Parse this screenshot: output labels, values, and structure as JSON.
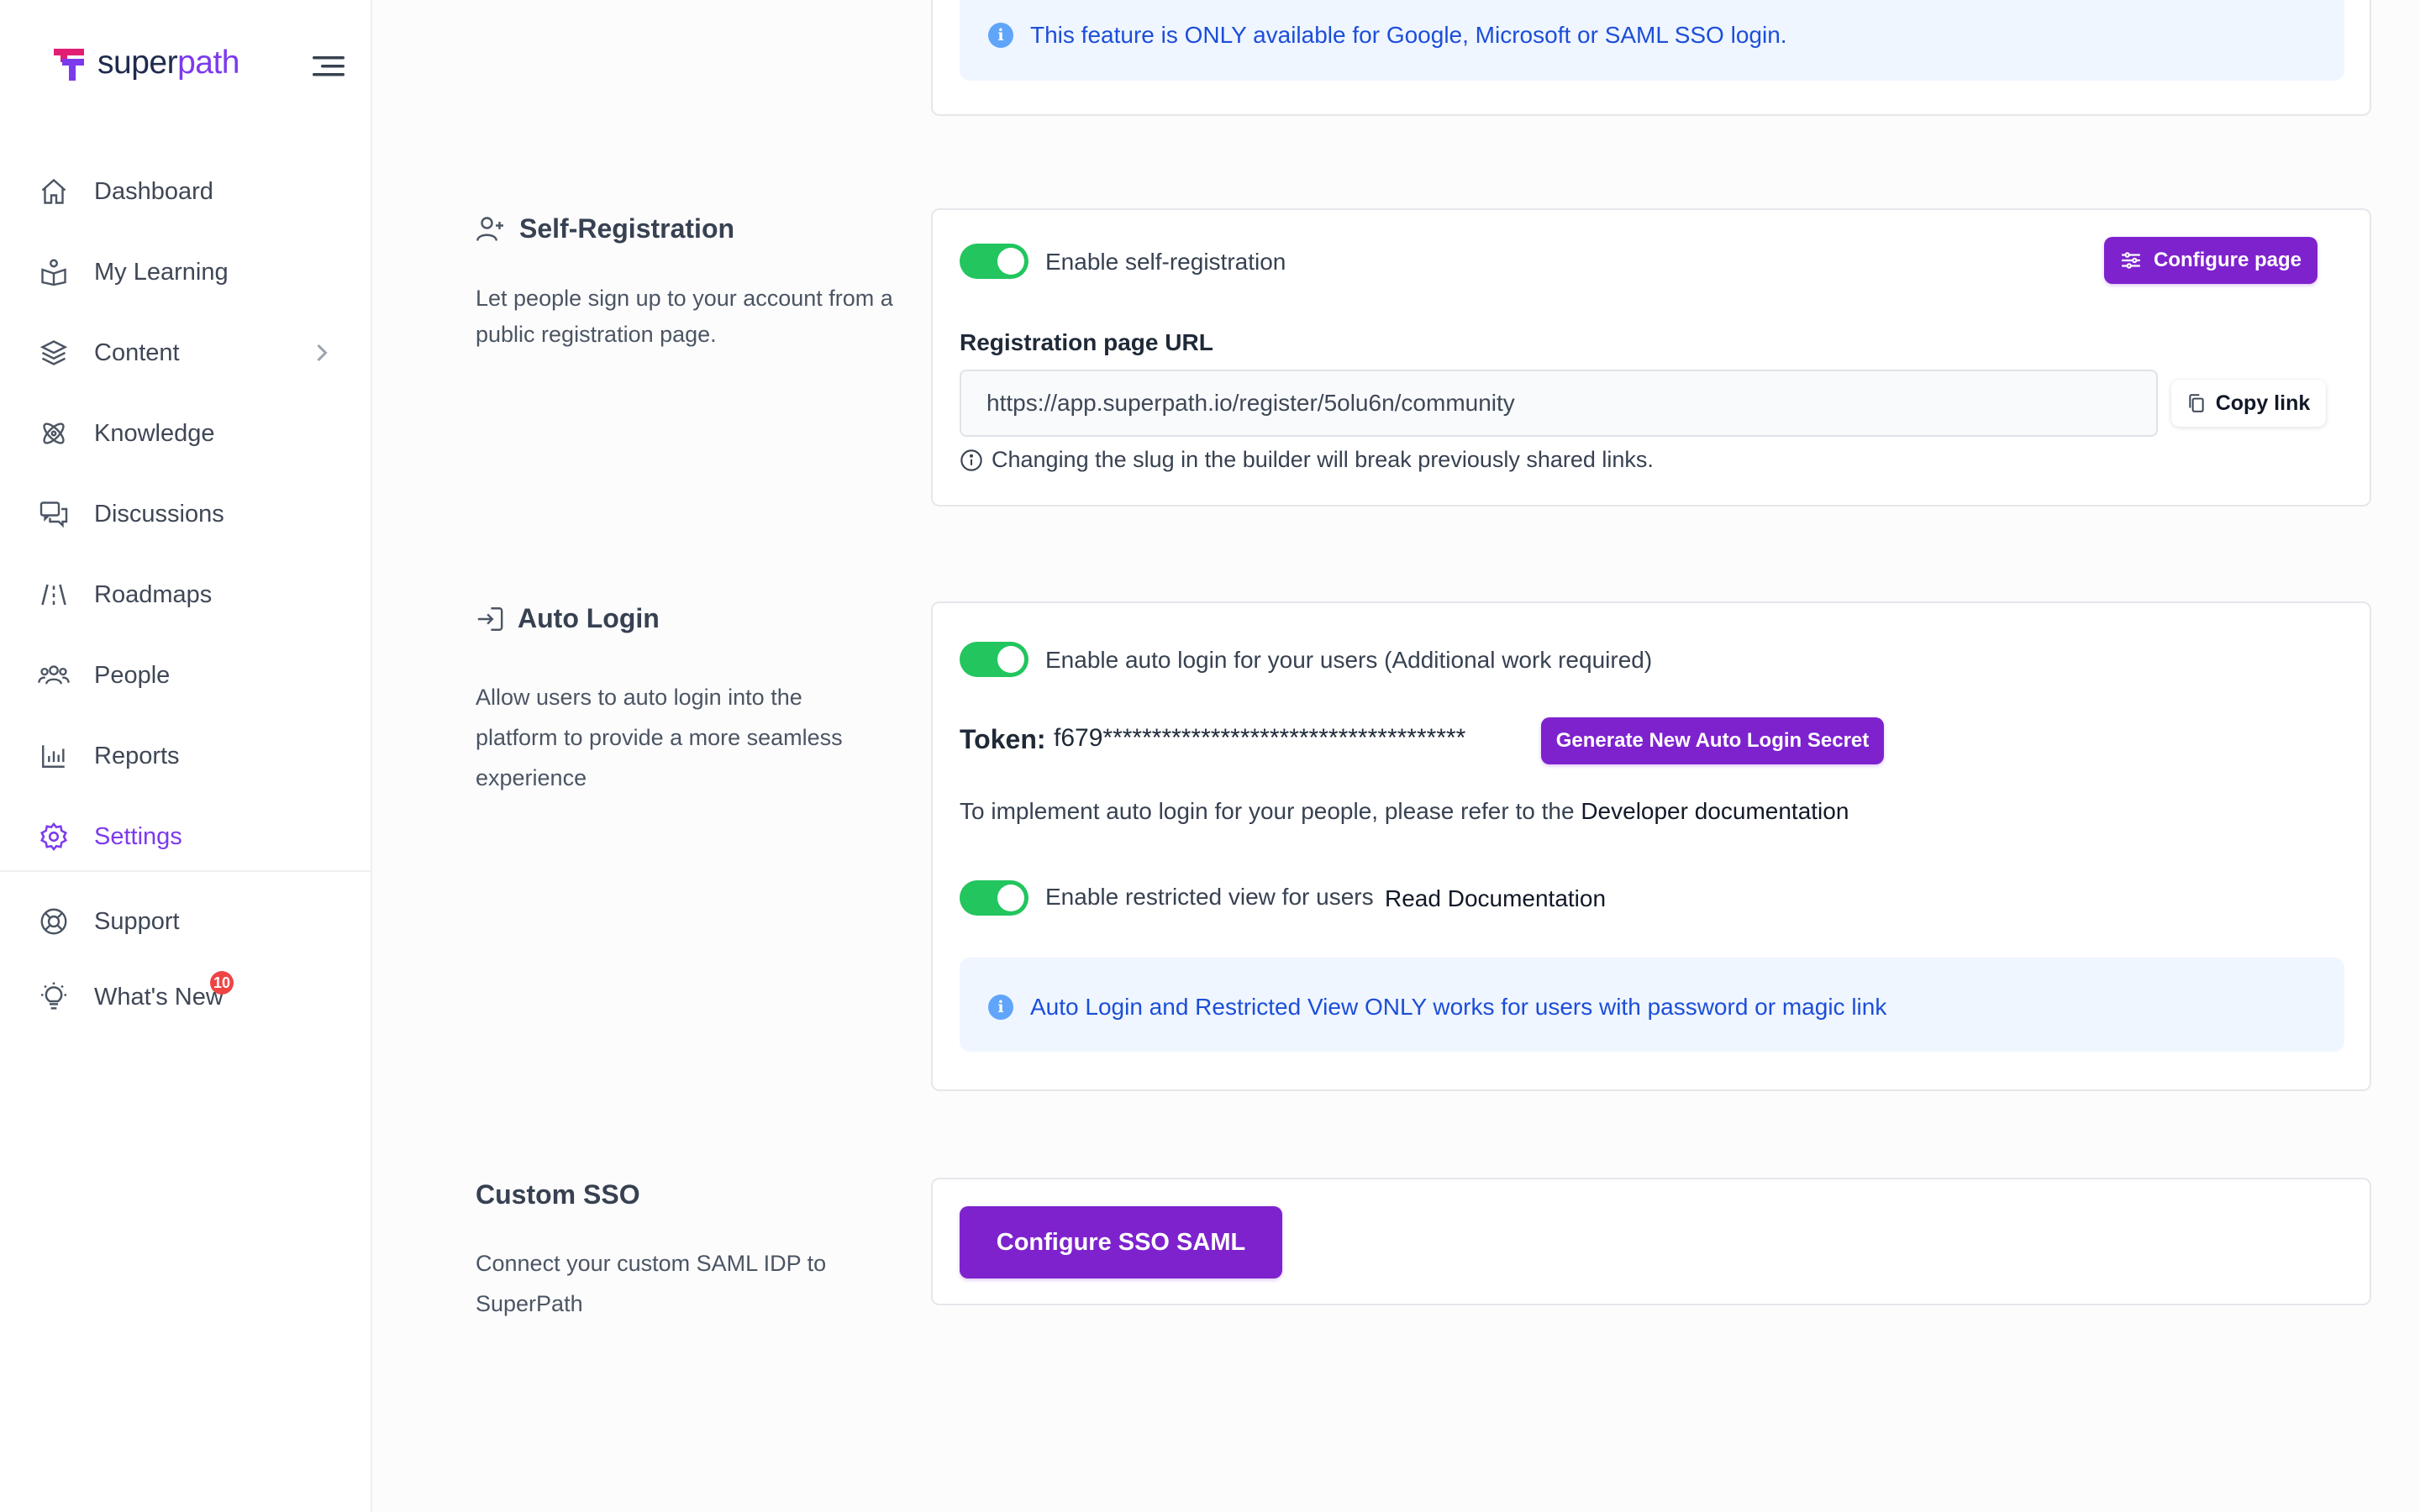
{
  "brand": {
    "name_prefix": "super",
    "name_suffix": "path",
    "accent": "#7c3aed"
  },
  "sidebar": {
    "items": [
      {
        "label": "Dashboard",
        "icon": "home-icon"
      },
      {
        "label": "My Learning",
        "icon": "learning-icon"
      },
      {
        "label": "Content",
        "icon": "layers-icon"
      },
      {
        "label": "Knowledge",
        "icon": "atom-icon"
      },
      {
        "label": "Discussions",
        "icon": "chat-icon"
      },
      {
        "label": "Roadmaps",
        "icon": "road-icon"
      },
      {
        "label": "People",
        "icon": "users-icon"
      },
      {
        "label": "Reports",
        "icon": "bar-chart-icon"
      },
      {
        "label": "Settings",
        "icon": "gear-icon"
      }
    ],
    "bottom": [
      {
        "label": "Support",
        "icon": "lifebuoy-icon"
      },
      {
        "label": "What's New",
        "icon": "bulb-icon",
        "badge": "10"
      }
    ]
  },
  "sso_notice": {
    "text": "This feature is ONLY available for Google, Microsoft or SAML SSO login."
  },
  "self_registration": {
    "title": "Self-Registration",
    "description": "Let people sign up to your account from a public registration page.",
    "toggle_label": "Enable self-registration",
    "configure_label": "Configure page",
    "url_label": "Registration page URL",
    "url_value": "https://app.superpath.io/register/5olu6n/community",
    "copy_label": "Copy link",
    "warning": "Changing the slug in the builder will break previously shared links."
  },
  "auto_login": {
    "title": "Auto Login",
    "description": "Allow users to auto login into the platform to provide a more seamless experience",
    "toggle_label": "Enable auto login for your users (Additional work required)",
    "token_label": "Token:",
    "token_value": "f679*************************************",
    "generate_label": "Generate New Auto Login Secret",
    "implement_text": "To implement auto login for your people, please refer to the",
    "developer_link": "Developer documentation",
    "restricted_label": "Enable restricted view for users",
    "read_docs": "Read Documentation",
    "notice": "Auto Login and Restricted View ONLY works for users with password or magic link"
  },
  "custom_sso": {
    "title": "Custom SSO",
    "description": "Connect your custom SAML IDP to SuperPath",
    "button_label": "Configure SSO SAML"
  }
}
